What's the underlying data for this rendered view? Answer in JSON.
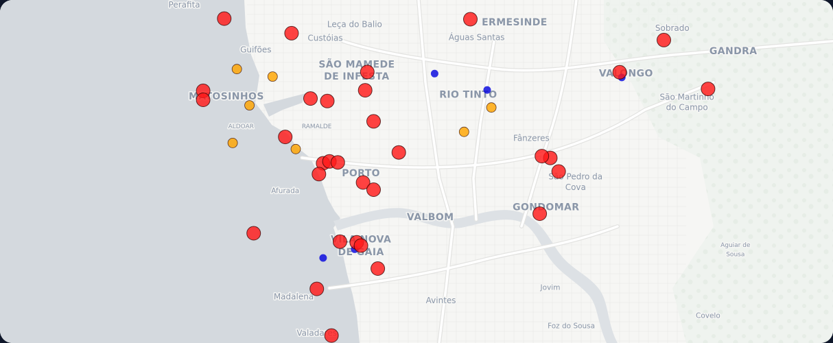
{
  "map": {
    "labels": [
      {
        "text": "Perafita",
        "size": "mid",
        "lat": 41.233,
        "lon": -8.706
      },
      {
        "text": "Leça do Balio",
        "size": "mid",
        "lat": 41.2173,
        "lon": -8.625
      },
      {
        "text": "Custóias",
        "size": "mid",
        "lat": 41.2063,
        "lon": -8.639
      },
      {
        "text": "ERMESINDE",
        "size": "big",
        "lat": 41.2187,
        "lon": -8.549
      },
      {
        "text": "Águas Santas",
        "size": "mid",
        "lat": 41.2069,
        "lon": -8.567
      },
      {
        "text": "Sobrado",
        "size": "mid",
        "lat": 41.2142,
        "lon": -8.474
      },
      {
        "text": "GANDRA",
        "size": "big",
        "lat": 41.1955,
        "lon": -8.445
      },
      {
        "text": "Guifões",
        "size": "mid",
        "lat": 41.1968,
        "lon": -8.672
      },
      {
        "text": "SÃO MAMEDE",
        "size": "big",
        "lat": 41.1849,
        "lon": -8.624
      },
      {
        "text": "DE INFESTA",
        "size": "big",
        "lat": 41.1752,
        "lon": -8.624
      },
      {
        "text": "VALONGO",
        "size": "big",
        "lat": 41.1776,
        "lon": -8.496
      },
      {
        "text": "MATOSINHOS",
        "size": "big",
        "lat": 41.1593,
        "lon": -8.686
      },
      {
        "text": "RIO TINTO",
        "size": "big",
        "lat": 41.1605,
        "lon": -8.571
      },
      {
        "text": "São Martinho",
        "size": "mid",
        "lat": 41.1591,
        "lon": -8.467
      },
      {
        "text": "do Campo",
        "size": "mid",
        "lat": 41.1506,
        "lon": -8.467
      },
      {
        "text": "ALDOAR",
        "size": "tiny",
        "lat": 41.1361,
        "lon": -8.679
      },
      {
        "text": "RAMALDE",
        "size": "tiny",
        "lat": 41.1361,
        "lon": -8.643
      },
      {
        "text": "Fânzeres",
        "size": "mid",
        "lat": 41.126,
        "lon": -8.541
      },
      {
        "text": "PORTO",
        "size": "big",
        "lat": 41.0976,
        "lon": -8.622
      },
      {
        "text": "São Pedro da",
        "size": "mid",
        "lat": 41.0951,
        "lon": -8.52
      },
      {
        "text": "Cova",
        "size": "mid",
        "lat": 41.0866,
        "lon": -8.52
      },
      {
        "text": "Afurada",
        "size": "small",
        "lat": 41.0842,
        "lon": -8.658
      },
      {
        "text": "GONDOMAR",
        "size": "big",
        "lat": 41.0705,
        "lon": -8.534
      },
      {
        "text": "VALBOM",
        "size": "big",
        "lat": 41.0625,
        "lon": -8.589
      },
      {
        "text": "VILA NOVA",
        "size": "big",
        "lat": 41.0446,
        "lon": -8.622
      },
      {
        "text": "DE GAIA",
        "size": "big",
        "lat": 41.0343,
        "lon": -8.622
      },
      {
        "text": "Aguiar de",
        "size": "tiny",
        "lat": 41.0411,
        "lon": -8.444
      },
      {
        "text": "Sousa",
        "size": "tiny",
        "lat": 41.0336,
        "lon": -8.444
      },
      {
        "text": "Jovim",
        "size": "small",
        "lat": 41.0066,
        "lon": -8.532
      },
      {
        "text": "Madalena",
        "size": "mid",
        "lat": 40.9989,
        "lon": -8.654
      },
      {
        "text": "Avintes",
        "size": "mid",
        "lat": 40.996,
        "lon": -8.584
      },
      {
        "text": "Covelo",
        "size": "small",
        "lat": 40.9842,
        "lon": -8.457
      },
      {
        "text": "Foz do Sousa",
        "size": "small",
        "lat": 40.9758,
        "lon": -8.522
      },
      {
        "text": "Valadares",
        "size": "mid",
        "lat": 40.9697,
        "lon": -8.643
      }
    ],
    "colors": {
      "land": "#f6f6f4",
      "sea": "#d4d9de",
      "river": "#dde1e5",
      "road": "#ffffff",
      "road_casing": "#e4e4e2",
      "high_marker": "#ff1a1a",
      "medium_marker": "#ffa500",
      "low_marker": "#0000dd"
    },
    "markers": [
      {
        "lat": 41.2241,
        "lon": -8.687,
        "level": "high"
      },
      {
        "lat": 41.2124,
        "lon": -8.655,
        "level": "high"
      },
      {
        "lat": 41.2236,
        "lon": -8.57,
        "level": "high"
      },
      {
        "lat": 41.2069,
        "lon": -8.478,
        "level": "high"
      },
      {
        "lat": 41.1811,
        "lon": -8.499,
        "level": "high"
      },
      {
        "lat": 41.1677,
        "lon": -8.457,
        "level": "high"
      },
      {
        "lat": 41.1813,
        "lon": -8.619,
        "level": "high"
      },
      {
        "lat": 41.1666,
        "lon": -8.62,
        "level": "high"
      },
      {
        "lat": 41.1662,
        "lon": -8.697,
        "level": "high"
      },
      {
        "lat": 41.159,
        "lon": -8.697,
        "level": "high"
      },
      {
        "lat": 41.16,
        "lon": -8.646,
        "level": "high"
      },
      {
        "lat": 41.158,
        "lon": -8.638,
        "level": "high"
      },
      {
        "lat": 41.1417,
        "lon": -8.616,
        "level": "high"
      },
      {
        "lat": 41.1292,
        "lon": -8.658,
        "level": "high"
      },
      {
        "lat": 41.1168,
        "lon": -8.604,
        "level": "high"
      },
      {
        "lat": 41.1124,
        "lon": -8.532,
        "level": "high"
      },
      {
        "lat": 41.1138,
        "lon": -8.536,
        "level": "high"
      },
      {
        "lat": 41.1015,
        "lon": -8.528,
        "level": "high"
      },
      {
        "lat": 41.1081,
        "lon": -8.64,
        "level": "high"
      },
      {
        "lat": 41.1096,
        "lon": -8.637,
        "level": "high"
      },
      {
        "lat": 41.1088,
        "lon": -8.633,
        "level": "high"
      },
      {
        "lat": 41.0994,
        "lon": -8.642,
        "level": "high"
      },
      {
        "lat": 41.0927,
        "lon": -8.621,
        "level": "high"
      },
      {
        "lat": 41.0869,
        "lon": -8.616,
        "level": "high"
      },
      {
        "lat": 41.0677,
        "lon": -8.537,
        "level": "high"
      },
      {
        "lat": 41.052,
        "lon": -8.673,
        "level": "high"
      },
      {
        "lat": 41.0453,
        "lon": -8.632,
        "level": "high"
      },
      {
        "lat": 41.0447,
        "lon": -8.624,
        "level": "high"
      },
      {
        "lat": 41.0421,
        "lon": -8.622,
        "level": "high"
      },
      {
        "lat": 41.0237,
        "lon": -8.614,
        "level": "high"
      },
      {
        "lat": 41.0074,
        "lon": -8.643,
        "level": "high"
      },
      {
        "lat": 40.97,
        "lon": -8.636,
        "level": "high"
      },
      {
        "lat": 41.1836,
        "lon": -8.681,
        "level": "medium"
      },
      {
        "lat": 41.1776,
        "lon": -8.664,
        "level": "medium"
      },
      {
        "lat": 41.1545,
        "lon": -8.675,
        "level": "medium"
      },
      {
        "lat": 41.1244,
        "lon": -8.683,
        "level": "medium"
      },
      {
        "lat": 41.1195,
        "lon": -8.653,
        "level": "medium"
      },
      {
        "lat": 41.1528,
        "lon": -8.56,
        "level": "medium"
      },
      {
        "lat": 41.1333,
        "lon": -8.573,
        "level": "medium"
      },
      {
        "lat": 41.18,
        "lon": -8.587,
        "level": "low"
      },
      {
        "lat": 41.1669,
        "lon": -8.562,
        "level": "low"
      },
      {
        "lat": 41.1769,
        "lon": -8.498,
        "level": "low"
      },
      {
        "lat": 41.0322,
        "lon": -8.64,
        "level": "low"
      },
      {
        "lat": 41.0392,
        "lon": -8.625,
        "level": "low"
      }
    ]
  }
}
